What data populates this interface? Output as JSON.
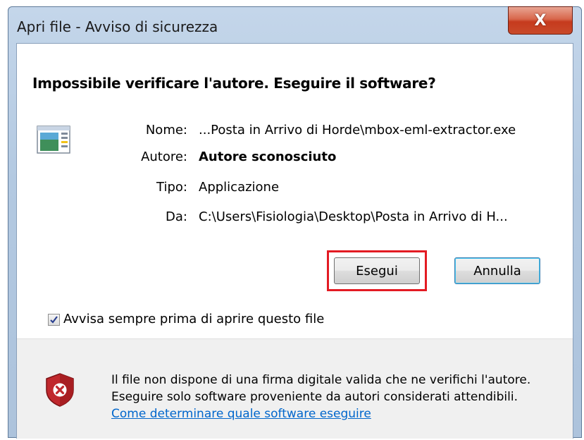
{
  "window": {
    "title": "Apri file - Avviso di sicurezza",
    "close_glyph": "X"
  },
  "dialog": {
    "heading": "Impossibile verificare l'autore. Eseguire il software?",
    "file_icon": "application-icon",
    "details": [
      {
        "label": "Nome:",
        "value": "...Posta in Arrivo di Horde\\mbox-eml-extractor.exe",
        "bold": false
      },
      {
        "label": "Autore:",
        "value": "Autore sconosciuto",
        "bold": true
      },
      {
        "label": "Tipo:",
        "value": "Applicazione",
        "bold": false
      },
      {
        "label": "Da:",
        "value": "C:\\Users\\Fisiologia\\Desktop\\Posta in Arrivo di H...",
        "bold": false
      }
    ],
    "buttons": {
      "run": "Esegui",
      "cancel": "Annulla"
    },
    "checkbox": {
      "label": "Avvisa sempre prima di aprire questo file",
      "checked": true
    },
    "footer": {
      "shield_icon": "security-warning-shield-icon",
      "line1": "Il file non dispone di una firma digitale valida che ne verifichi l'autore.",
      "line2": "Eseguire solo software proveniente da autori considerati attendibili.",
      "link": "Come determinare quale software eseguire"
    }
  },
  "colors": {
    "highlight": "#e31b23",
    "link": "#0066cc",
    "close_button": "#c63a1d"
  }
}
